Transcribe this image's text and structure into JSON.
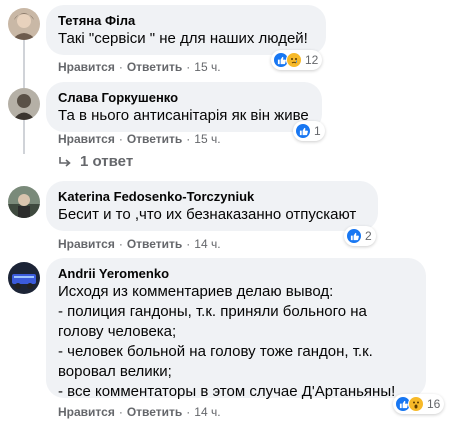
{
  "comments": [
    {
      "author": "Тетяна Філа",
      "text": "Такі \"сервіси \" не для наших людей!",
      "like_label": "Нравится",
      "reply_label": "Ответить",
      "time": "15 ч.",
      "reactions": [
        "like",
        "sad"
      ],
      "reaction_count": "12"
    },
    {
      "author": "Слава Горкушенко",
      "text": "Та в нього антисанітарія як він живе",
      "like_label": "Нравится",
      "reply_label": "Ответить",
      "time": "15 ч.",
      "reactions": [
        "like"
      ],
      "reaction_count": "1",
      "replies_label": "1 ответ"
    },
    {
      "author": "Katerina Fedosenko-Torczyniuk",
      "text": "Бесит и то ,что их безнаказанно отпускают",
      "like_label": "Нравится",
      "reply_label": "Ответить",
      "time": "14 ч.",
      "reactions": [
        "like"
      ],
      "reaction_count": "2"
    },
    {
      "author": "Andrii Yeromenko",
      "text": "Исходя из комментариев делаю вывод:\n- полиция гандоны, т.к. приняли больного на голову человека;\n- человек больной на голову тоже гандон, т.к. воровал велики;\n- все комментаторы в этом случае Д'Артаньяны!",
      "like_label": "Нравится",
      "reply_label": "Ответить",
      "time": "14 ч.",
      "reactions": [
        "like",
        "wow"
      ],
      "reaction_count": "16"
    }
  ],
  "colors": {
    "bubble_bg": "#f0f2f5",
    "meta_text": "#65676b",
    "like_blue": "#1877f2",
    "emoji_yellow": "#f7b928"
  },
  "icons": [
    "like-icon",
    "sad-icon",
    "wow-icon",
    "reply-arrow-icon"
  ]
}
